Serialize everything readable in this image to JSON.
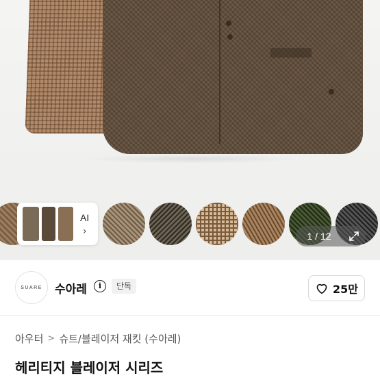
{
  "gallery": {
    "ai_label": "AI",
    "ai_chevron": "›",
    "counter": "1 / 12",
    "expand_icon": "expand-icon",
    "swatch_colors": [
      "#a0815f",
      "#8a7a66",
      "#3f3a30",
      "#c2a585",
      "#8a6a48",
      "#2f3a22",
      "#3a3a3a"
    ]
  },
  "shop": {
    "logo_text": "SUARE",
    "name": "수아레",
    "info_icon": "i",
    "badge": "단독",
    "like_count": "25만"
  },
  "breadcrumb": {
    "items": [
      "아우터",
      "슈트/블레이저 재킷 (수아레)"
    ],
    "separator": ">"
  },
  "product": {
    "title": "헤리티지 블레이저 시리즈"
  }
}
